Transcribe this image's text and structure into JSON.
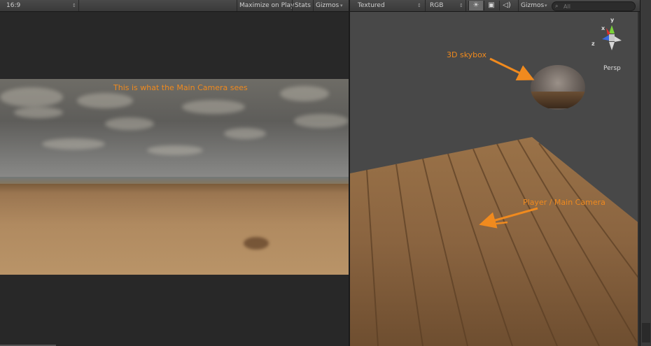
{
  "game": {
    "aspect_label": "16:9",
    "maximize_label": "Maximize on Play",
    "stats_label": "Stats",
    "gizmos_label": "Gizmos",
    "annotation": "This is what the Main Camera sees"
  },
  "scene": {
    "render_mode": "Textured",
    "channel": "RGB",
    "gizmos_label": "Gizmos",
    "search_placeholder": "All",
    "projection_label": "Persp",
    "axes": {
      "x": "x",
      "y": "y",
      "z": "z"
    },
    "annotations": {
      "skybox": "3D skybox",
      "player": "Player / Main Camera"
    }
  },
  "colors": {
    "annotation": "#f08a1e",
    "axis_x": "#e03030",
    "axis_y": "#7ad23a",
    "axis_z": "#3a6ae0"
  },
  "icons": [
    "dropdown-caret-icon",
    "sun-light-icon",
    "image-icon",
    "audio-icon",
    "search-icon"
  ]
}
